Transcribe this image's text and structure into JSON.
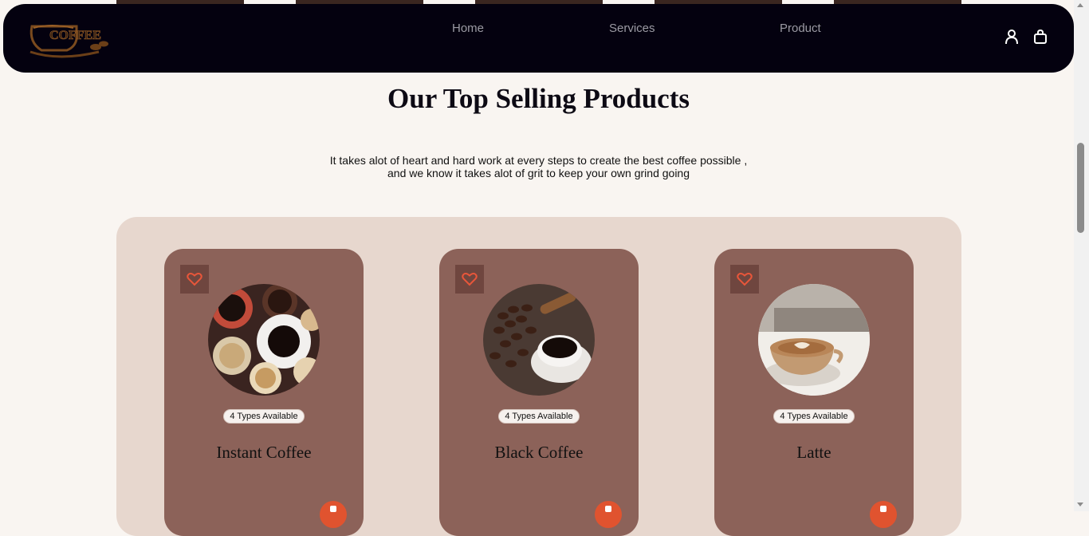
{
  "navbar": {
    "logo_text": "COFFEE",
    "links": [
      "Home",
      "Services",
      "Product"
    ],
    "icons": [
      "user-icon",
      "shopping-bag-icon"
    ]
  },
  "section": {
    "title": "Our Top Selling Products",
    "subtitle_line1": "It takes alot of heart and hard work at every steps to create the best coffee possible ,",
    "subtitle_line2": "and we know it takes alot of grit to keep your own grind going"
  },
  "products": [
    {
      "name": "Instant Coffee",
      "badge": "4 Types Available",
      "image": "instant-coffee-cups-photo"
    },
    {
      "name": "Black Coffee",
      "badge": "4 Types Available",
      "image": "black-coffee-beans-photo"
    },
    {
      "name": "Latte",
      "badge": "4 Types Available",
      "image": "latte-art-photo"
    }
  ],
  "colors": {
    "navbar_bg": "#04010f",
    "page_bg": "#f9f5f1",
    "panel_bg": "#e7d7ce",
    "card_bg": "#8c6259",
    "accent": "#e0532f"
  }
}
